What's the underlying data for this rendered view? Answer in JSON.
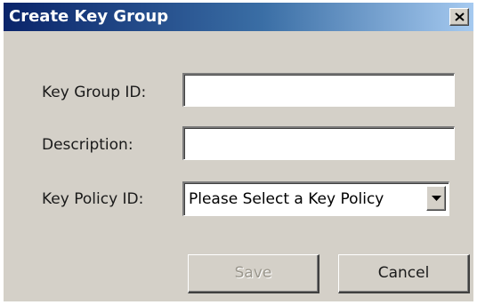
{
  "dialog": {
    "title": "Create Key Group",
    "close_icon": "close-icon"
  },
  "form": {
    "key_group_id": {
      "label": "Key Group ID:",
      "value": ""
    },
    "description": {
      "label": "Description:",
      "value": ""
    },
    "key_policy_id": {
      "label": "Key Policy ID:",
      "selected": "Please Select a Key Policy",
      "arrow_icon": "chevron-down-icon"
    }
  },
  "buttons": {
    "save_label": "Save",
    "save_disabled": true,
    "cancel_label": "Cancel"
  },
  "colors": {
    "title_gradient_start": "#0a246a",
    "title_gradient_end": "#a6caf0",
    "dialog_background": "#d4d0c8",
    "disabled_text": "#9a968c"
  }
}
